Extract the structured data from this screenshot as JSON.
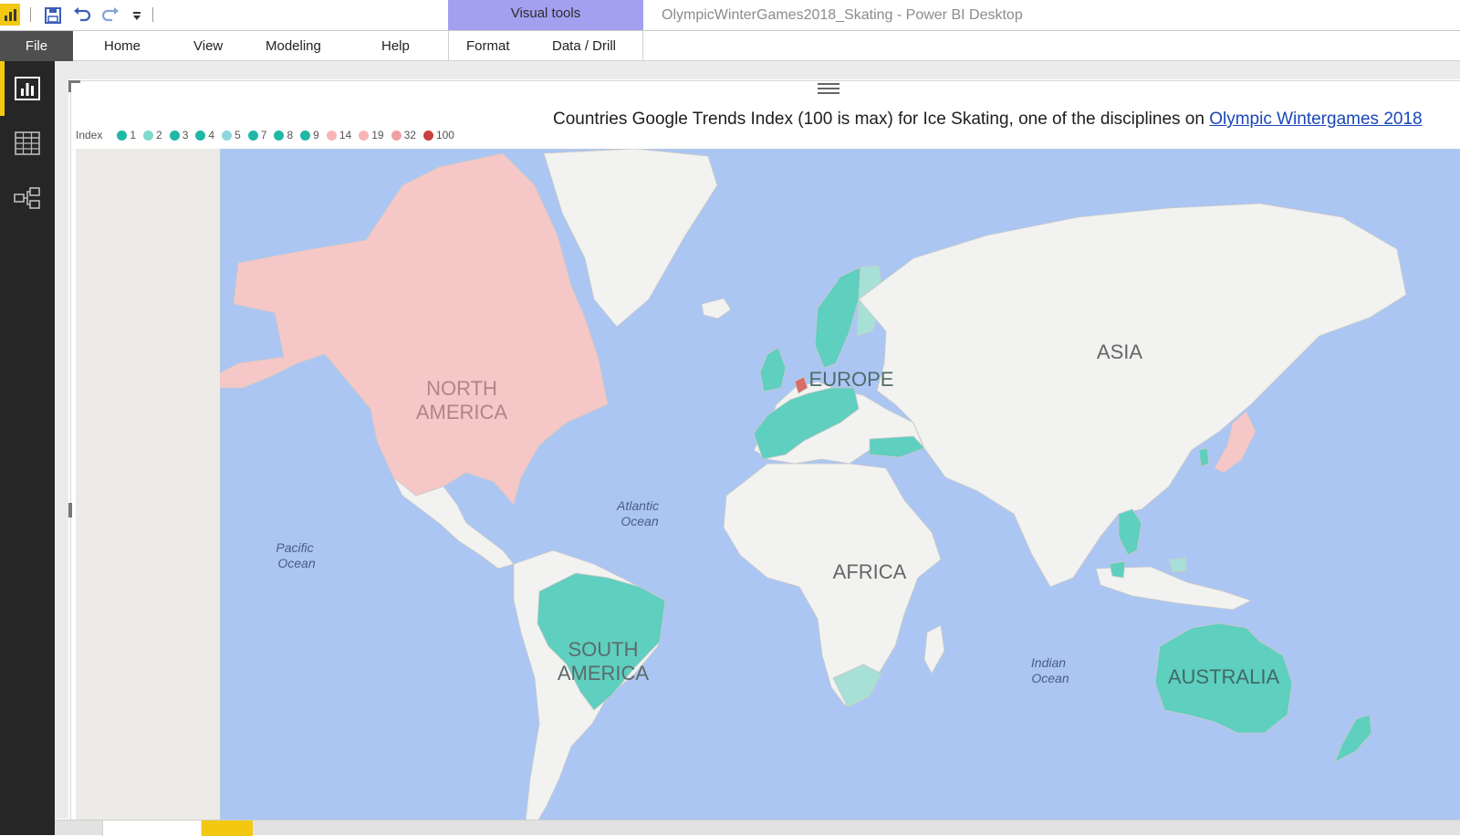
{
  "titlebar": {
    "contextual_group": "Visual tools",
    "window_title": "OlympicWinterGames2018_Skating - Power BI Desktop"
  },
  "ribbon": {
    "file": "File",
    "tabs": [
      "Home",
      "View",
      "Modeling",
      "Help",
      "Format",
      "Data / Drill"
    ]
  },
  "legend": {
    "title": "Index",
    "items": [
      {
        "label": "1",
        "color": "#1fb8a6"
      },
      {
        "label": "2",
        "color": "#7fd9cc"
      },
      {
        "label": "3",
        "color": "#1fb8a6"
      },
      {
        "label": "4",
        "color": "#1fb8a6"
      },
      {
        "label": "5",
        "color": "#8fd6df"
      },
      {
        "label": "7",
        "color": "#1fb8a6"
      },
      {
        "label": "8",
        "color": "#1fb8a6"
      },
      {
        "label": "9",
        "color": "#1fb8a6"
      },
      {
        "label": "14",
        "color": "#f7b6b6"
      },
      {
        "label": "19",
        "color": "#f7b6b6"
      },
      {
        "label": "32",
        "color": "#f0a0a0"
      },
      {
        "label": "100",
        "color": "#c84040"
      }
    ]
  },
  "chart": {
    "title_text": "Countries Google Trends Index (100 is max) for Ice Skating, one of the disciplines on ",
    "title_link": "Olympic Wintergames 2018"
  },
  "map": {
    "labels": {
      "north_america_1": "NORTH",
      "north_america_2": "AMERICA",
      "south_america_1": "SOUTH",
      "south_america_2": "AMERICA",
      "europe": "EUROPE",
      "asia": "ASIA",
      "africa": "AFRICA",
      "australia": "AUSTRALIA",
      "atlantic_1": "Atlantic",
      "atlantic_2": "Ocean",
      "pacific_1": "Pacific",
      "pacific_2": "Ocean",
      "indian_1": "Indian",
      "indian_2": "Ocean"
    },
    "colors": {
      "ocean": "#abc6f2",
      "land": "#f2f2f0",
      "teal": "#5fcfbf",
      "light_teal": "#a6e0d6",
      "pink": "#f6c7c7",
      "red": "#d96b6b"
    }
  }
}
